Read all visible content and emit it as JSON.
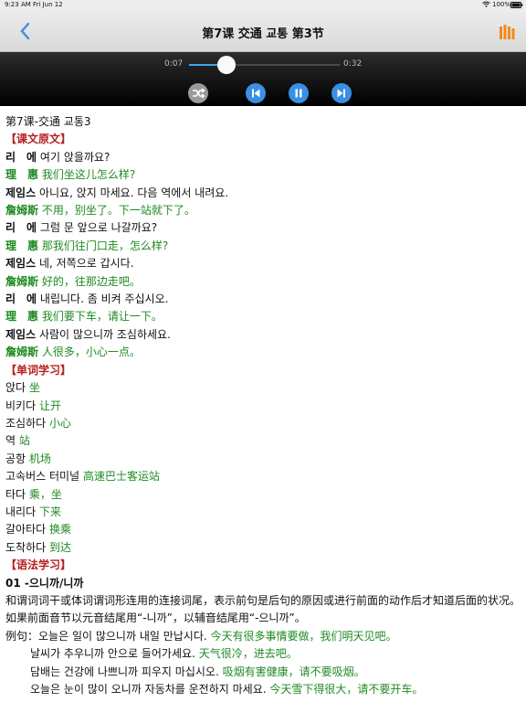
{
  "status_bar": {
    "time": "9:23 AM",
    "date": "Fri Jun 12",
    "battery": "100%"
  },
  "nav": {
    "title": "第7课 交通 교통 第3节",
    "back_icon": "chevron-left-icon",
    "menu_icon": "bars-icon",
    "accent": "#3a8ee6",
    "menu_color": "#f08a1c"
  },
  "player": {
    "elapsed": "0:07",
    "duration": "0:32",
    "progress": 0.22
  },
  "lesson": {
    "title": "第7课-交通 교통3",
    "sec_text": "【课文原文】",
    "dialog": [
      {
        "speaker": "리　에",
        "text": "여기 앉을까요?",
        "zh": false
      },
      {
        "speaker": "理　惠",
        "text": "我们坐这儿怎么样?",
        "zh": true
      },
      {
        "speaker": "제임스",
        "text": "아니요, 앉지 마세요. 다음 역에서 내려요.",
        "zh": false
      },
      {
        "speaker": "詹姆斯",
        "text": "不用，别坐了。下一站就下了。",
        "zh": true
      },
      {
        "speaker": "리　에",
        "text": "그럼 문 앞으로 나갈까요?",
        "zh": false
      },
      {
        "speaker": "理　惠",
        "text": "那我们往门口走，怎么样?",
        "zh": true
      },
      {
        "speaker": "제임스",
        "text": "네, 저쪽으로 갑시다.",
        "zh": false
      },
      {
        "speaker": "詹姆斯",
        "text": "好的，往那边走吧。",
        "zh": true
      },
      {
        "speaker": "리　에",
        "text": "내립니다. 좀 비켜 주십시오.",
        "zh": false
      },
      {
        "speaker": "理　惠",
        "text": "我们要下车，请让一下。",
        "zh": true
      },
      {
        "speaker": "제임스",
        "text": "사람이 많으니까 조심하세요.",
        "zh": false
      },
      {
        "speaker": "詹姆斯",
        "text": "人很多，小心一点。",
        "zh": true
      }
    ],
    "sec_vocab": "【单词学习】",
    "vocab": [
      {
        "ko": "앉다",
        "zh": "坐"
      },
      {
        "ko": "비키다",
        "zh": "让开"
      },
      {
        "ko": "조심하다",
        "zh": "小心"
      },
      {
        "ko": "역",
        "zh": "站"
      },
      {
        "ko": "공항",
        "zh": "机场"
      },
      {
        "ko": "고속버스 터미널",
        "zh": "高速巴士客运站"
      },
      {
        "ko": "타다",
        "zh": "乘，坐"
      },
      {
        "ko": "내리다",
        "zh": "下来"
      },
      {
        "ko": "갈아타다",
        "zh": "换乘"
      },
      {
        "ko": "도착하다",
        "zh": "到达"
      }
    ],
    "sec_grammar": "【语法学习】",
    "grammar_title": "01 -으니까/니까",
    "grammar_desc": "和谓词词干或体词谓词形连用的连接词尾，表示前句是后句的原因或进行前面的动作后才知道后面的状况。如果前面音节以元音结尾用“-니까”，以辅音结尾用“-으니까”。",
    "example_label": "例句：",
    "examples": [
      {
        "ko": "오늘은 일이 많으니까 내일 만납시다.",
        "zh": "今天有很多事情要做，我们明天见吧。"
      },
      {
        "ko": "날씨가 추우니까 안으로 들어가세요.",
        "zh": "天气很冷，进去吧。"
      },
      {
        "ko": "담배는 건강에 나쁘니까 피우지 마십시오.",
        "zh": "吸烟有害健康，请不要吸烟。"
      },
      {
        "ko": "오늘은 눈이 많이 오니까 자동차를 운전하지 마세요.",
        "zh": "今天雪下得很大，请不要开车。"
      }
    ]
  }
}
